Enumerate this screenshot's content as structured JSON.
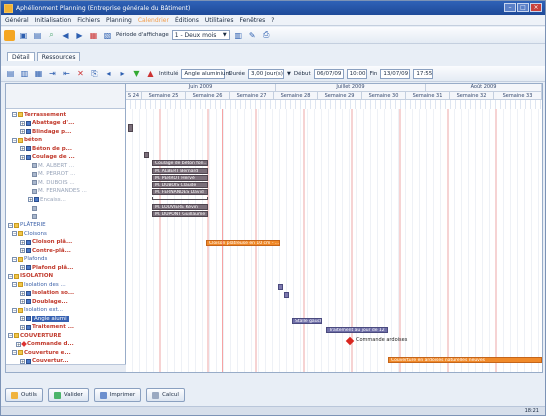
{
  "window": {
    "title": "Aphélionment Planning (Entreprise générale du Bâtiment)"
  },
  "menu": [
    "Général",
    "Initialisation",
    "Fichiers",
    "Planning",
    "Calendrier",
    "Éditions",
    "Utilitaires",
    "Fenêtres",
    "?"
  ],
  "toolbar1": {
    "display_label": "Période d'affichage",
    "display_value": "1 - Deux mois"
  },
  "tabs": [
    "Détail",
    "Ressources"
  ],
  "toolbar2": {
    "intitule_label": "Intitulé",
    "intitule_value": "Angle aluminium",
    "duree_label": "Durée",
    "duree_value": "3,00 Jour(s)",
    "debut_label": "Début",
    "debut_date": "06/07/09",
    "debut_time": "10:00",
    "fin_label": "Fin",
    "fin_date": "13/07/09",
    "fin_time": "17:55"
  },
  "timeline": {
    "months": [
      "Juin 2009",
      "Juillet 2009",
      "Août 2009"
    ],
    "weeks": [
      "S 24",
      "Semaine 25",
      "Semaine 26",
      "Semaine 27",
      "Semaine 28",
      "Semaine 29",
      "Semaine 30",
      "Semaine 31",
      "Semaine 32",
      "Semaine 33"
    ]
  },
  "tree": [
    {
      "label": "Terrassement",
      "style": "red",
      "icon": "folder"
    },
    {
      "label": "Abattage d'...",
      "style": "red",
      "icon": "task"
    },
    {
      "label": "Blindage p...",
      "style": "red",
      "icon": "task"
    },
    {
      "label": "béton",
      "style": "red",
      "icon": "folder"
    },
    {
      "label": "Béton de p...",
      "style": "red",
      "icon": "task"
    },
    {
      "label": "Coulage de ...",
      "style": "red",
      "icon": "task"
    },
    {
      "label": "M. ALBERT ...",
      "style": "grey",
      "icon": "res"
    },
    {
      "label": "M. PERROT ...",
      "style": "grey",
      "icon": "res"
    },
    {
      "label": "M. DUBOIS ...",
      "style": "grey",
      "icon": "res"
    },
    {
      "label": "M. FERNANDES ...",
      "style": "grey",
      "icon": "res"
    },
    {
      "label": "Encaiss...",
      "style": "grey",
      "icon": "task"
    },
    {
      "label": "",
      "style": "grey",
      "icon": "res"
    },
    {
      "label": "",
      "style": "grey",
      "icon": "res"
    },
    {
      "label": "PLÂTERIE",
      "style": "blue",
      "icon": "folder"
    },
    {
      "label": "Cloisons",
      "style": "blue",
      "icon": "folder"
    },
    {
      "label": "Cloison plâ...",
      "style": "red",
      "icon": "task"
    },
    {
      "label": "Contre-plâ...",
      "style": "red",
      "icon": "task"
    },
    {
      "label": "Plafonds",
      "style": "blue",
      "icon": "folder"
    },
    {
      "label": "Plafond plâ...",
      "style": "red",
      "icon": "task"
    },
    {
      "label": "ISOLATION",
      "style": "red",
      "icon": "folder"
    },
    {
      "label": "Isolation des ...",
      "style": "blue",
      "icon": "folder"
    },
    {
      "label": "Isolation so...",
      "style": "red",
      "icon": "task"
    },
    {
      "label": "Doublage...",
      "style": "red",
      "icon": "task"
    },
    {
      "label": "Isolation ext...",
      "style": "blue",
      "icon": "folder"
    },
    {
      "label": "Angle alumi",
      "style": "selected",
      "icon": "task"
    },
    {
      "label": "Traitement ...",
      "style": "red",
      "icon": "task"
    },
    {
      "label": "COUVERTURE",
      "style": "red",
      "icon": "folder"
    },
    {
      "label": "Commande d...",
      "style": "red",
      "icon": "milestone"
    },
    {
      "label": "Couverture e...",
      "style": "red",
      "icon": "folder"
    },
    {
      "label": "Couvertur...",
      "style": "red",
      "icon": "task"
    }
  ],
  "gantt": {
    "coulage_bar": "Coulage de béton fon...",
    "resources": [
      "M. ALBERT Bernard",
      "M. PERROT Hervé",
      "M. DUBOIS Claude",
      "M. FERNANDES David",
      "M. LOUVIERE Kévin",
      "M. DUPONT Guillaume"
    ],
    "cloison_bar": "Cloison plâtreuse en 10 cm - ...",
    "isolation_bar": "Stalle gauche",
    "traitement_bar": "Traitement au jour de 12",
    "milestone_label": "Commande ardoises",
    "couverture_bar": "Couverture en ardoises naturelles neuves"
  },
  "buttons": {
    "outils": "Outils",
    "valider": "Valider",
    "imprimer": "Imprimer",
    "calcul": "Calcul"
  },
  "status": {
    "right": "18:21"
  },
  "colors": {
    "title": "#1e4a99",
    "orange_bar": "#f08a2a",
    "grey_bar": "#7b6f7a",
    "milestone": "#d9261f"
  }
}
